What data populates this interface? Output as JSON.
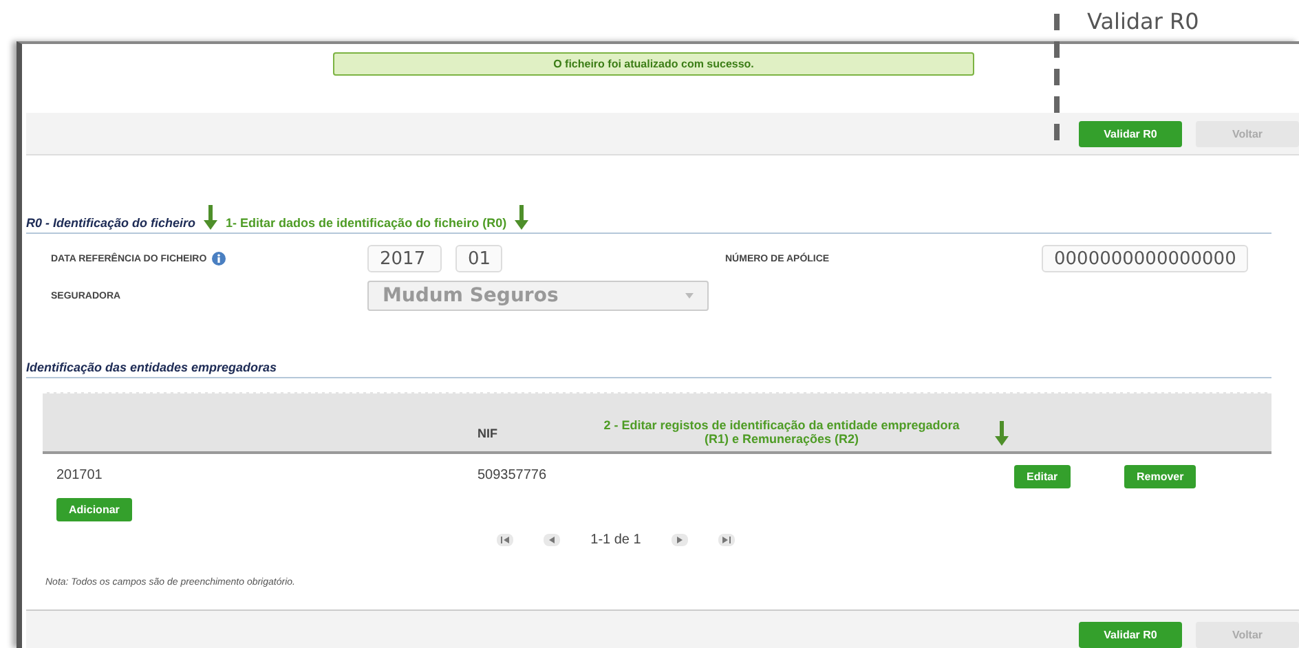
{
  "callout": {
    "text": "Validar R0"
  },
  "message": "O ficheiro foi atualizado com sucesso.",
  "toolbar": {
    "buttons": [
      {
        "label": "Validar R0",
        "disabled": false
      },
      {
        "label": "Voltar",
        "disabled": true
      }
    ]
  },
  "section_r0": {
    "title": "R0 - Identificação do ficheiro",
    "step_note": "1- Editar dados de identificação do ficheiro (R0)",
    "fields": {
      "date_label": "DATA REFERÊNCIA DO FICHEIRO",
      "year": "2017",
      "month": "01",
      "policy_label": "NÚMERO DE APÓLICE",
      "policy_value": "0000000000000000",
      "insurer_label": "SEGURADORA",
      "insurer_value": "Mudum Seguros"
    }
  },
  "section_entities": {
    "title": "Identificação das entidades empregadoras",
    "step_note": "2 - Editar registos de identificação da entidade empregadora (R1) e Remunerações (R2)",
    "table": {
      "columns": [
        "",
        "NIF"
      ],
      "rows": [
        {
          "cells": [
            "201701",
            "509357776"
          ],
          "actions": [
            "Editar",
            "Remover"
          ]
        }
      ]
    },
    "add_button": "Adicionar",
    "pager": "1-1 de 1"
  },
  "note": "Nota: Todos os campos são de preenchimento obrigatório.",
  "footer": {
    "buttons": [
      {
        "label": "Validar R0",
        "disabled": false
      },
      {
        "label": "Voltar",
        "disabled": true
      }
    ]
  }
}
